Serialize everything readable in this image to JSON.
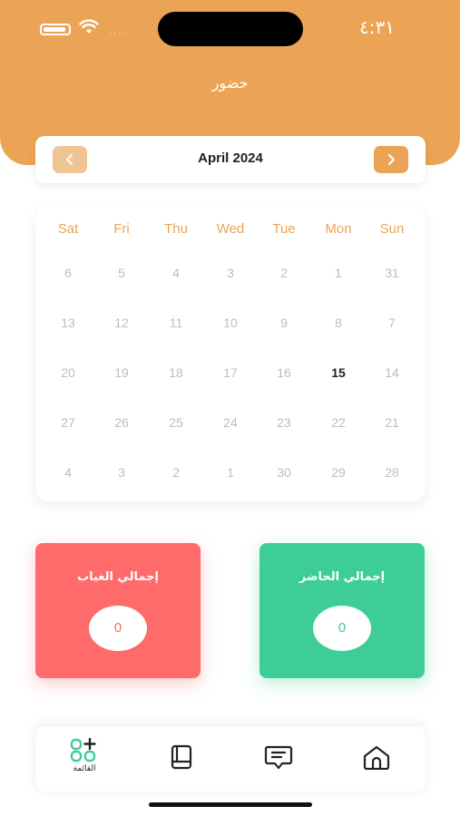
{
  "status_bar": {
    "time": "٤:٣١",
    "signal": "...."
  },
  "header": {
    "title": "حضور"
  },
  "calendar": {
    "month_label": "April 2024",
    "weekdays": [
      "Sat",
      "Fri",
      "Thu",
      "Wed",
      "Tue",
      "Mon",
      "Sun"
    ],
    "rows": [
      [
        "6",
        "5",
        "4",
        "3",
        "2",
        "1",
        "31"
      ],
      [
        "13",
        "12",
        "11",
        "10",
        "9",
        "8",
        "7"
      ],
      [
        "20",
        "19",
        "18",
        "17",
        "16",
        "15",
        "14"
      ],
      [
        "27",
        "26",
        "25",
        "24",
        "23",
        "22",
        "21"
      ],
      [
        "4",
        "3",
        "2",
        "1",
        "30",
        "29",
        "28"
      ]
    ],
    "today": "15"
  },
  "stats": {
    "absent": {
      "label": "إجمالي الغياب",
      "value": "0"
    },
    "present": {
      "label": "إجمالي الحاضر",
      "value": "0"
    }
  },
  "bottom_nav": {
    "items": [
      {
        "icon": "grid-add-icon",
        "label": "القائمة"
      },
      {
        "icon": "book-icon"
      },
      {
        "icon": "chat-icon"
      },
      {
        "icon": "home-icon"
      }
    ]
  },
  "colors": {
    "accent": "#EBA455",
    "absent": "#FF6A6A",
    "present": "#3ECD97"
  }
}
